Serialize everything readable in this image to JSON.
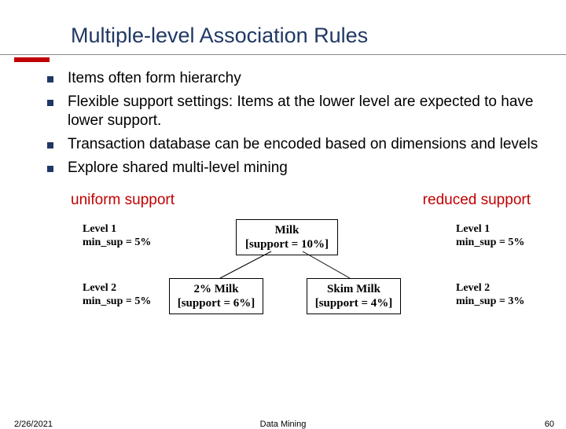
{
  "title": "Multiple-level Association Rules",
  "bullets": [
    "Items often form hierarchy",
    "Flexible support settings: Items at the lower level are expected to have lower support.",
    "Transaction database can be encoded based on dimensions and levels",
    "Explore shared multi-level mining"
  ],
  "labels": {
    "uniform": "uniform support",
    "reduced": "reduced support"
  },
  "left": {
    "l1a": "Level 1",
    "l1b": "min_sup = 5%",
    "l2a": "Level 2",
    "l2b": "min_sup = 5%"
  },
  "right": {
    "l1a": "Level 1",
    "l1b": "min_sup = 5%",
    "l2a": "Level 2",
    "l2b": "min_sup = 3%"
  },
  "boxes": {
    "milk1": "Milk",
    "milk2": "[support = 10%]",
    "two1": "2% Milk",
    "two2": "[support = 6%]",
    "skim1": "Skim Milk",
    "skim2": "[support = 4%]"
  },
  "footer": {
    "date": "2/26/2021",
    "center": "Data Mining",
    "page": "60"
  }
}
